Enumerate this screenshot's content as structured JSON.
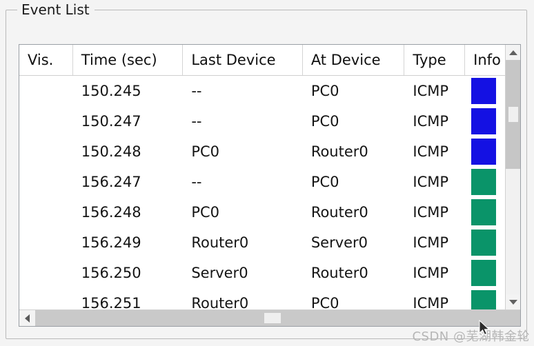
{
  "groupbox": {
    "title": "Event List"
  },
  "table": {
    "columns": [
      {
        "key": "vis",
        "label": "Vis."
      },
      {
        "key": "time",
        "label": "Time (sec)"
      },
      {
        "key": "last",
        "label": "Last Device"
      },
      {
        "key": "at",
        "label": "At Device"
      },
      {
        "key": "type",
        "label": "Type"
      },
      {
        "key": "info",
        "label": "Info"
      }
    ],
    "rows": [
      {
        "vis": "",
        "time": "150.245",
        "last": "--",
        "at": "PC0",
        "type": "ICMP",
        "color": "#1411e3"
      },
      {
        "vis": "",
        "time": "150.247",
        "last": "--",
        "at": "PC0",
        "type": "ICMP",
        "color": "#1411e3"
      },
      {
        "vis": "",
        "time": "150.248",
        "last": "PC0",
        "at": "Router0",
        "type": "ICMP",
        "color": "#1411e3"
      },
      {
        "vis": "",
        "time": "156.247",
        "last": "--",
        "at": "PC0",
        "type": "ICMP",
        "color": "#0a9469"
      },
      {
        "vis": "",
        "time": "156.248",
        "last": "PC0",
        "at": "Router0",
        "type": "ICMP",
        "color": "#0a9469"
      },
      {
        "vis": "",
        "time": "156.249",
        "last": "Router0",
        "at": "Server0",
        "type": "ICMP",
        "color": "#0a9469"
      },
      {
        "vis": "",
        "time": "156.250",
        "last": "Server0",
        "at": "Router0",
        "type": "ICMP",
        "color": "#0a9469"
      },
      {
        "vis": "",
        "time": "156.251",
        "last": "Router0",
        "at": "PC0",
        "type": "ICMP",
        "color": "#0a9469"
      },
      {
        "vis": "",
        "time": "",
        "last": "",
        "at": "",
        "type": "",
        "color": "#1411e3"
      }
    ]
  },
  "scrollbars": {
    "vertical": {
      "up_arrow": "chevron-up-icon",
      "down_arrow": "chevron-down-icon"
    },
    "horizontal": {
      "left_arrow": "chevron-left-icon"
    }
  },
  "watermark": {
    "text": "CSDN @芜湖韩金轮"
  },
  "colors": {
    "swatch_blue": "#1411e3",
    "swatch_green": "#0a9469",
    "frame_border": "#9a9fa5",
    "group_border": "#b9b9b9",
    "background": "#f4f4f4"
  }
}
